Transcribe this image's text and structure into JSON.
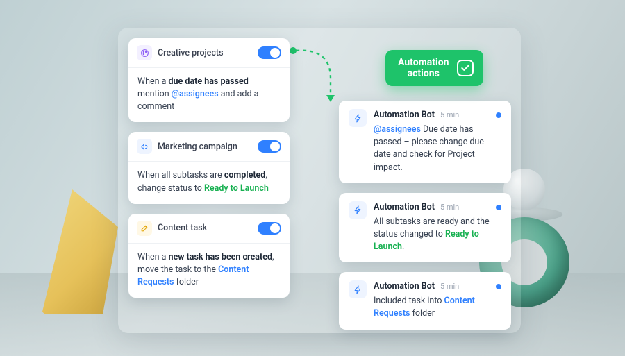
{
  "badge": {
    "line1": "Automation",
    "line2": "actions"
  },
  "cards": [
    {
      "title": "Creative projects",
      "body_pre": "When a ",
      "body_bold": "due date has passed",
      "body_mid": " mention ",
      "mention": "@assignees",
      "body_post": " and add a comment"
    },
    {
      "title": "Marketing campaign",
      "body_pre": "When all subtasks are ",
      "body_bold": "completed",
      "body_mid": ", change status to ",
      "link": "Ready to Launch",
      "body_post": ""
    },
    {
      "title": "Content task",
      "body_pre": "When a ",
      "body_bold": "new task has been created",
      "body_mid": ", move the task to the ",
      "link": "Content Requests",
      "body_post": " folder"
    }
  ],
  "notes": [
    {
      "title": "Automation Bot",
      "time": "5 min",
      "mention": "@assignees",
      "body_post": " Due date has passed – please change due date and check for Project impact."
    },
    {
      "title": "Automation Bot",
      "time": "5 min",
      "body_pre": "All subtasks are ready and the status changed to ",
      "link": "Ready to Launch",
      "body_post": "."
    },
    {
      "title": "Automation Bot",
      "time": "5 min",
      "body_pre": "Included task into ",
      "link": "Content Requests",
      "body_post": " folder"
    }
  ]
}
